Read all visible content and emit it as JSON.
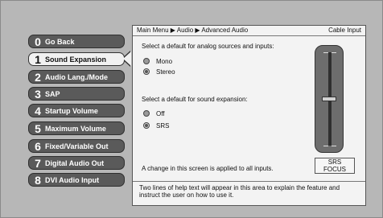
{
  "menu": {
    "items": [
      {
        "num": "0",
        "label": "Go Back"
      },
      {
        "num": "1",
        "label": "Sound Expansion",
        "selected": true
      },
      {
        "num": "2",
        "label": "Audio Lang./Mode"
      },
      {
        "num": "3",
        "label": "SAP"
      },
      {
        "num": "4",
        "label": "Startup Volume"
      },
      {
        "num": "5",
        "label": "Maximum Volume"
      },
      {
        "num": "6",
        "label": "Fixed/Variable Out"
      },
      {
        "num": "7",
        "label": "Digital Audio Out"
      },
      {
        "num": "8",
        "label": "DVI Audio Input"
      }
    ]
  },
  "breadcrumb": {
    "path": "Main Menu ▶ Audio ▶ Advanced Audio",
    "source": "Cable Input"
  },
  "analog": {
    "prompt": "Select a default for analog sources and inputs:",
    "options": [
      {
        "label": "Mono",
        "selected": false
      },
      {
        "label": "Stereo",
        "selected": true
      }
    ]
  },
  "expansion": {
    "prompt": "Select a default for sound expansion:",
    "options": [
      {
        "label": "Off",
        "selected": false
      },
      {
        "label": "SRS",
        "selected": true
      }
    ]
  },
  "note": "A change in this screen is applied to all inputs.",
  "help": "Two lines of help text will appear in this area to explain the feature and instruct the user on how to use it.",
  "focus": {
    "line1": "SRS",
    "line2": "FOCUS",
    "level": 0.5
  }
}
